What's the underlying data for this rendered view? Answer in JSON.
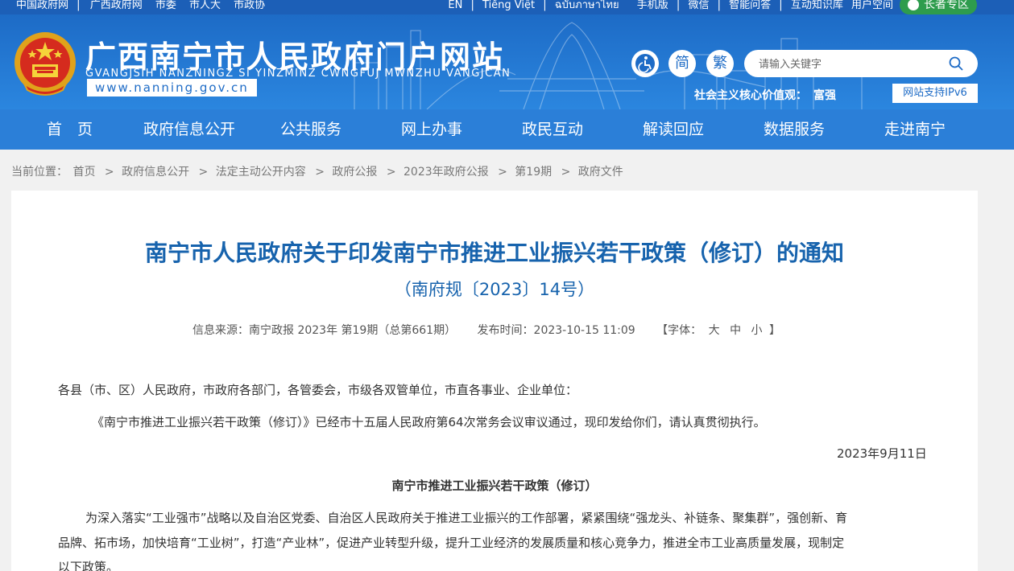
{
  "topbar": {
    "left_links": [
      "中国政府网",
      "|",
      "广西政府网",
      "市委",
      "市人大",
      "市政协"
    ],
    "right_links": [
      "EN",
      "|",
      "Tiếng Việt",
      "|",
      "ฉบับภาษาไทย",
      "手机版",
      "|",
      "微信",
      "|",
      "智能问答",
      "|",
      "互动知识库",
      "用户空间"
    ],
    "elder_label": "长者专区"
  },
  "header": {
    "title": "广西南宁市人民政府门户网站",
    "subtitle": "GVANGJSIH NANZNINGZ SI YINZMINZ CWNGFUJ MWNZHU VANGJCAN",
    "url": "www.nanning.gov.cn",
    "accessibility_icon": "accessibility-icon",
    "simplified_label": "简",
    "traditional_label": "繁",
    "search_placeholder": "请输入关键字",
    "values_label": "社会主义核心价值观：",
    "values_word": "富强",
    "ipv6_label": "网站支持IPv6"
  },
  "nav": [
    "首　页",
    "政府信息公开",
    "公共服务",
    "网上办事",
    "政民互动",
    "解读回应",
    "数据服务",
    "走进南宁"
  ],
  "breadcrumb": {
    "label": "当前位置：",
    "items": [
      "首页",
      "政府信息公开",
      "法定主动公开内容",
      "政府公报",
      "2023年政府公报",
      "第19期",
      "政府文件"
    ],
    "separator": ">"
  },
  "article": {
    "title": "南宁市人民政府关于印发南宁市推进工业振兴若干政策（修订）的通知",
    "doc_number": "（南府规〔2023〕14号）",
    "source": "信息来源：南宁政报 2023年 第19期（总第661期）",
    "publish_time": "发布时间：2023-10-15 11:09",
    "font_size_label": "【字体：",
    "font_sizes": [
      "大",
      "中",
      "小"
    ],
    "font_size_end": "】",
    "recipients": "各县（市、区）人民政府，市政府各部门，各管委会，市级各双管单位，市直各事业、企业单位：",
    "notice": "《南宁市推进工业振兴若干政策（修订）》已经市十五届人民政府第64次常务会议审议通过，现印发给你们，请认真贯彻执行。",
    "date": "2023年9月11日",
    "policy_title": "南宁市推进工业振兴若干政策（修订）",
    "body_lines": [
      "为深入落实“工业强市”战略以及自治区党委、自治区人民政府关于推进工业振兴的工作部署，紧紧围绕“强龙头、补链条、聚集群”，强创新、育",
      "品牌、拓市场，加快培育“工业树”，打造“产业林”，促进产业转型升级，提升工业经济的发展质量和核心竞争力，推进全市工业高质量发展，现制定",
      "以下政策。"
    ]
  }
}
